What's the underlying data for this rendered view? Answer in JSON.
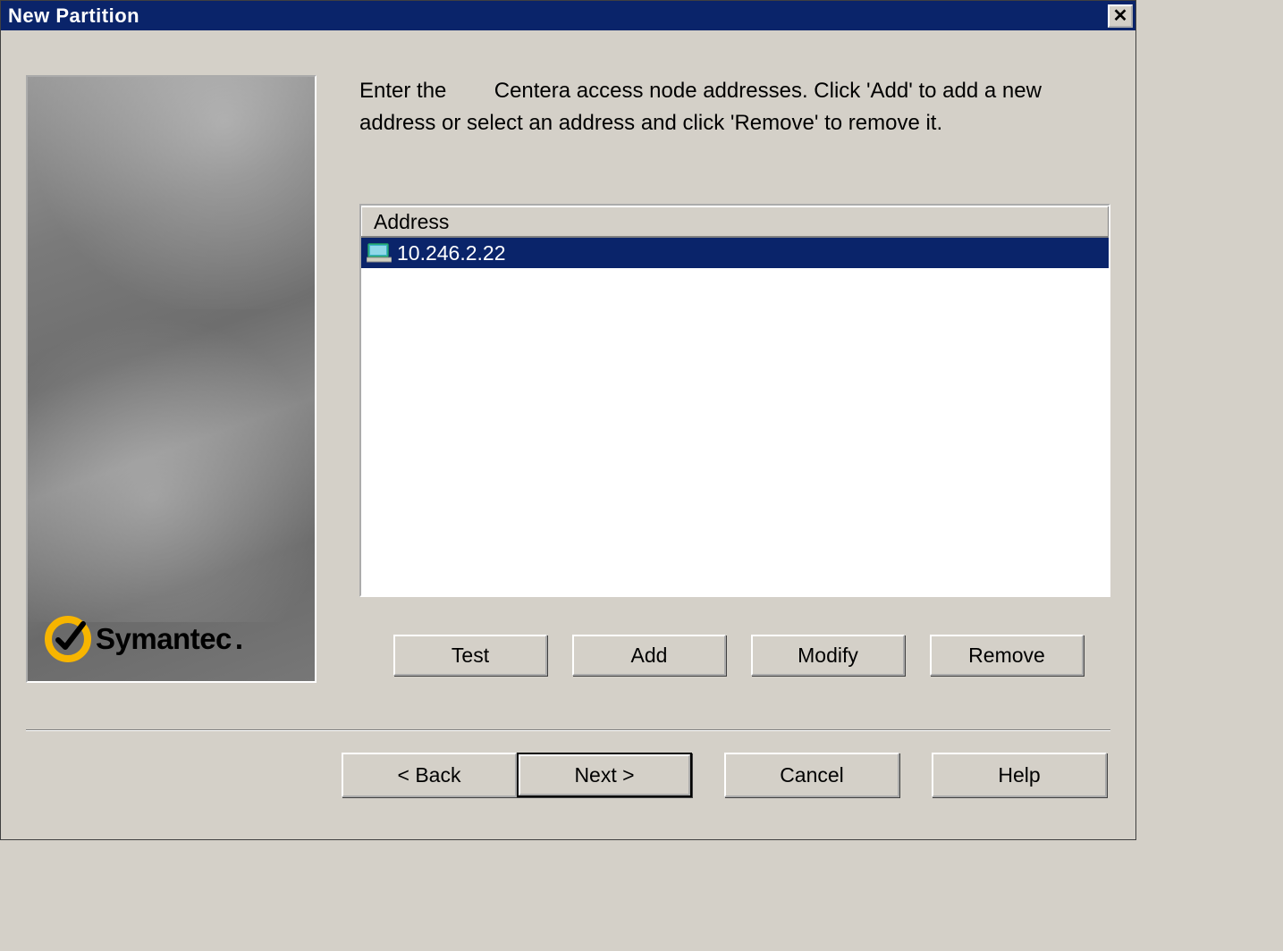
{
  "window": {
    "title": "New Partition"
  },
  "sidebar": {
    "brand": "Symantec"
  },
  "main": {
    "instruction": "Enter the        Centera access node addresses. Click 'Add' to add a new address or select an address and click 'Remove' to remove it.",
    "list": {
      "header": "Address",
      "rows": [
        {
          "address": "10.246.2.22",
          "selected": true
        }
      ]
    },
    "actions": {
      "test": "Test",
      "add": "Add",
      "modify": "Modify",
      "remove": "Remove"
    }
  },
  "nav": {
    "back": "< Back",
    "next": "Next >",
    "cancel": "Cancel",
    "help": "Help"
  }
}
